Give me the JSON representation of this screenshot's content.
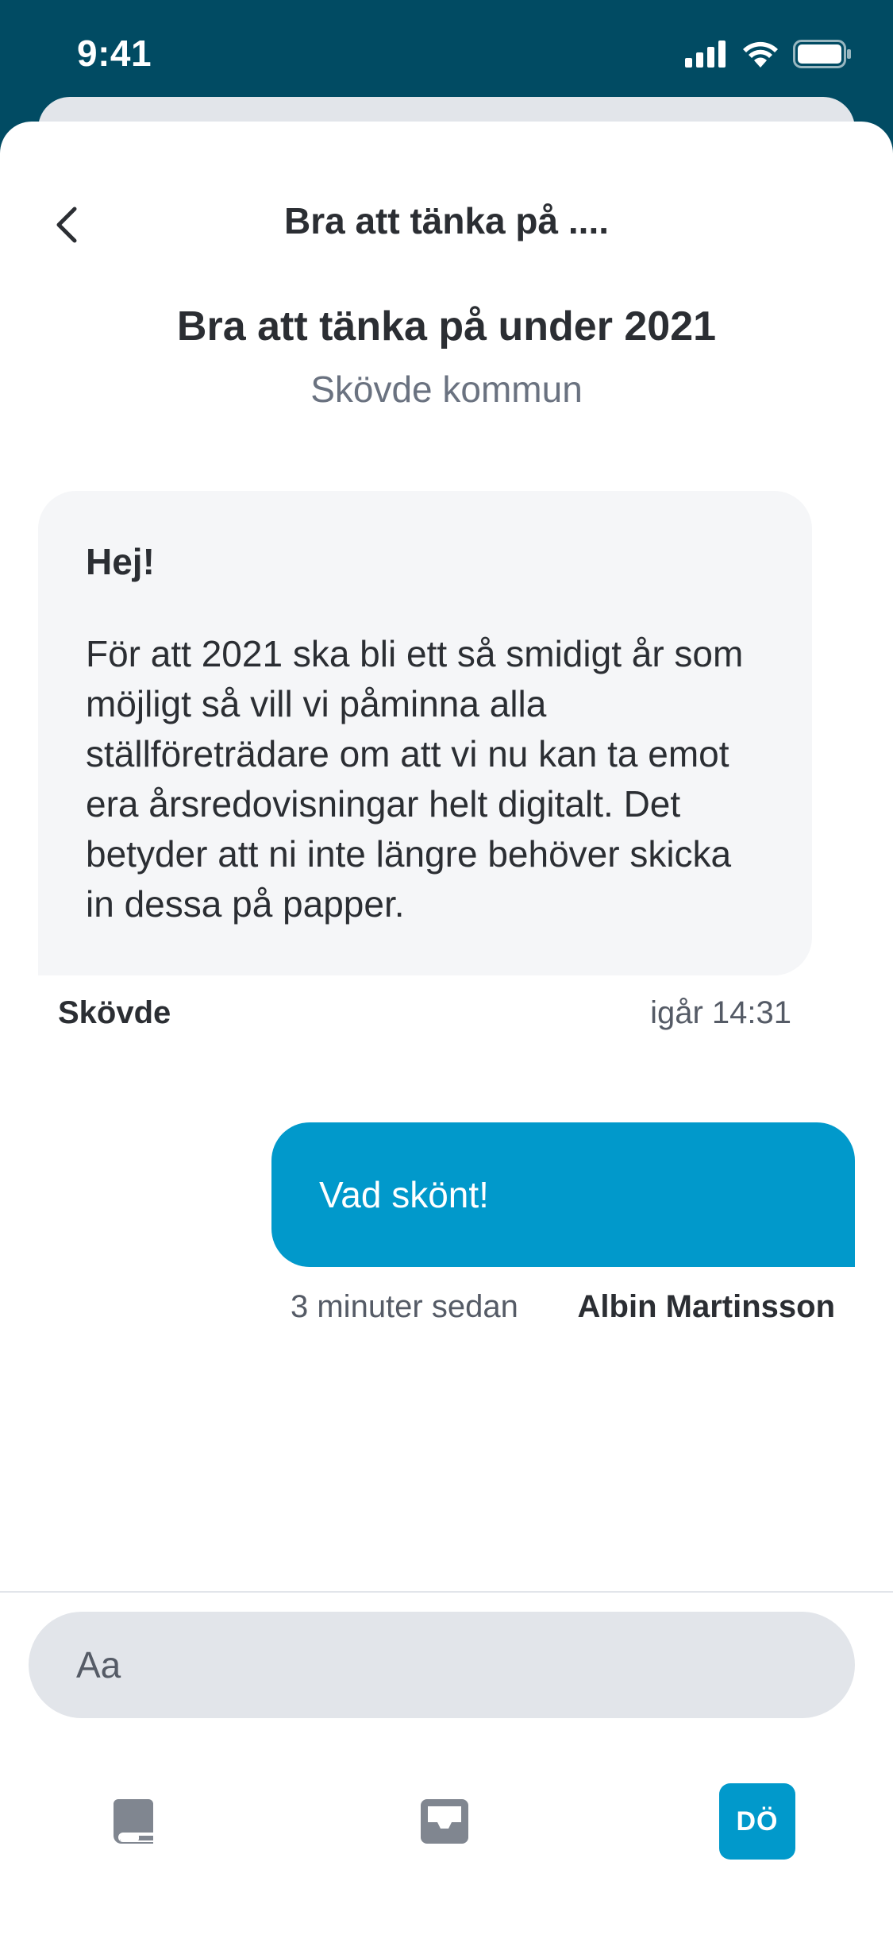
{
  "status_bar": {
    "time": "9:41"
  },
  "header": {
    "title": "Bra att tänka på ...."
  },
  "thread": {
    "title": "Bra att tänka på under 2021",
    "subtitle": "Skövde kommun"
  },
  "messages": [
    {
      "direction": "incoming",
      "greeting": "Hej!",
      "body": "För att 2021 ska bli ett så smidigt år som möjligt så vill vi påminna alla ställföreträdare om att vi nu kan ta emot era årsredovisningar helt digitalt. Det betyder att ni inte längre behöver skicka in dessa på papper.",
      "author": "Skövde",
      "time": "igår 14:31"
    },
    {
      "direction": "outgoing",
      "body": "Vad skönt!",
      "author": "Albin Martinsson",
      "time": "3 minuter sedan"
    }
  ],
  "composer": {
    "placeholder": "Aa"
  },
  "tabbar": {
    "items": [
      {
        "icon": "book-icon"
      },
      {
        "icon": "inbox-icon"
      },
      {
        "avatar_initials": "DÖ"
      }
    ]
  },
  "colors": {
    "status_bar": "#014B63",
    "accent": "#0199CB",
    "incoming_bubble": "#F5F6F8",
    "input": "#E2E5EA"
  }
}
